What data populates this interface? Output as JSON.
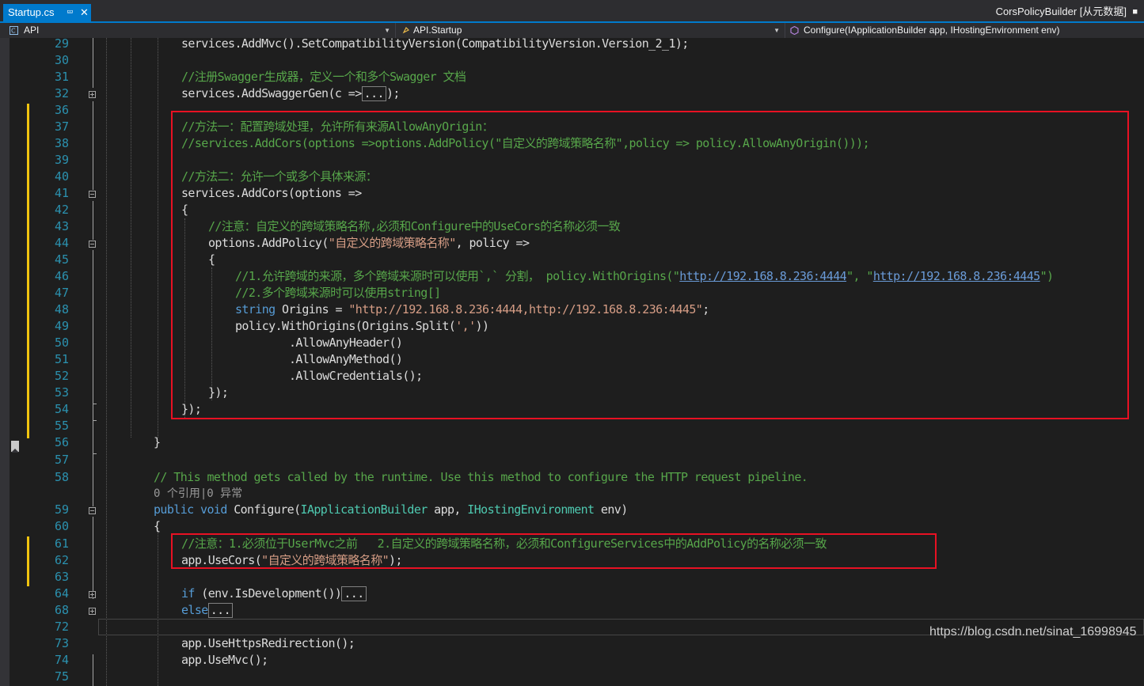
{
  "tabs": {
    "active_tab": "Startup.cs",
    "pin_icon": "pin-icon",
    "close_icon": "close-icon",
    "right_label": "CorsPolicyBuilder [从元数据]",
    "right_pin_icon": "pin-icon"
  },
  "navbar": {
    "project": "API",
    "type": "API.Startup",
    "member": "Configure(IApplicationBuilder app, IHostingEnvironment env)"
  },
  "editor": {
    "line_numbers": [
      "29",
      "30",
      "31",
      "32",
      "36",
      "37",
      "38",
      "39",
      "40",
      "41",
      "42",
      "43",
      "44",
      "45",
      "46",
      "47",
      "48",
      "49",
      "50",
      "51",
      "52",
      "53",
      "54",
      "55",
      "56",
      "57",
      "58",
      "59",
      "60",
      "61",
      "62",
      "63",
      "64",
      "68",
      "72",
      "73",
      "74",
      "75"
    ],
    "codelens": "0 个引用|0 异常",
    "collapsed_marker": "...",
    "lines": {
      "l29": "services.AddMvc().SetCompatibilityVersion(CompatibilityVersion.Version_2_1);",
      "l31": "//注册Swagger生成器，定义一个和多个Swagger 文档",
      "l32a": "services.AddSwaggerGen(c =>",
      "l32b": ");",
      "l37": "//方法一：配置跨域处理，允许所有来源AllowAnyOrigin：",
      "l38": "//services.AddCors(options =>options.AddPolicy(\"自定义的跨域策略名称\",policy => policy.AllowAnyOrigin()));",
      "l40": "//方法二：允许一个或多个具体来源：",
      "l41": "services.AddCors(options =>",
      "l42": "{",
      "l43": "//注意：自定义的跨域策略名称,必须和Configure中的UseCors的名称必须一致",
      "l44a": "options.AddPolicy(",
      "l44b": "\"自定义的跨域策略名称\"",
      "l44c": ", policy =>",
      "l45": "{",
      "l46a": "//1.允许跨域的来源，多个跨域来源时可以使用`,` 分割， policy.WithOrigins(\"",
      "l46b": "http://192.168.8.236:4444",
      "l46c": "\", \"",
      "l46d": "http://192.168.8.236:4445",
      "l46e": "\")",
      "l47": "//2.多个跨域来源时可以使用string[]",
      "l48a": "string",
      "l48b": " Origins = ",
      "l48c": "\"http://192.168.8.236:4444,http://192.168.8.236:4445\"",
      "l48d": ";",
      "l49a": "policy.WithOrigins(Origins.Split(",
      "l49b": "','",
      "l49c": "))",
      "l50": ".AllowAnyHeader()",
      "l51": ".AllowAnyMethod()",
      "l52": ".AllowCredentials();",
      "l53": "});",
      "l54": "});",
      "l56": "}",
      "l58": "// This method gets called by the runtime. Use this method to configure the HTTP request pipeline.",
      "l59a": "public",
      "l59b": "void",
      "l59c": " Configure(",
      "l59d": "IApplicationBuilder",
      "l59e": " app, ",
      "l59f": "IHostingEnvironment",
      "l59g": " env)",
      "l60": "{",
      "l61": "//注意：1.必须位于UserMvc之前   2.自定义的跨域策略名称，必须和ConfigureServices中的AddPolicy的名称必须一致",
      "l62a": "app.UseCors(",
      "l62b": "\"自定义的跨域策略名称\"",
      "l62c": ");",
      "l64a": "if",
      "l64b": " (env.IsDevelopment())",
      "l68": "else",
      "l73": "app.UseHttpsRedirection();",
      "l74": "app.UseMvc();"
    }
  },
  "watermark": "https://blog.csdn.net/sinat_16998945",
  "colors": {
    "background": "#1e1e1e",
    "accent": "#007acc",
    "comment": "#57a64a",
    "keyword": "#569cd6",
    "type": "#4ec9b0",
    "string": "#d69d85",
    "line_number": "#2b91af",
    "highlight_box": "#e81123",
    "change_bar": "#f1c40f"
  }
}
